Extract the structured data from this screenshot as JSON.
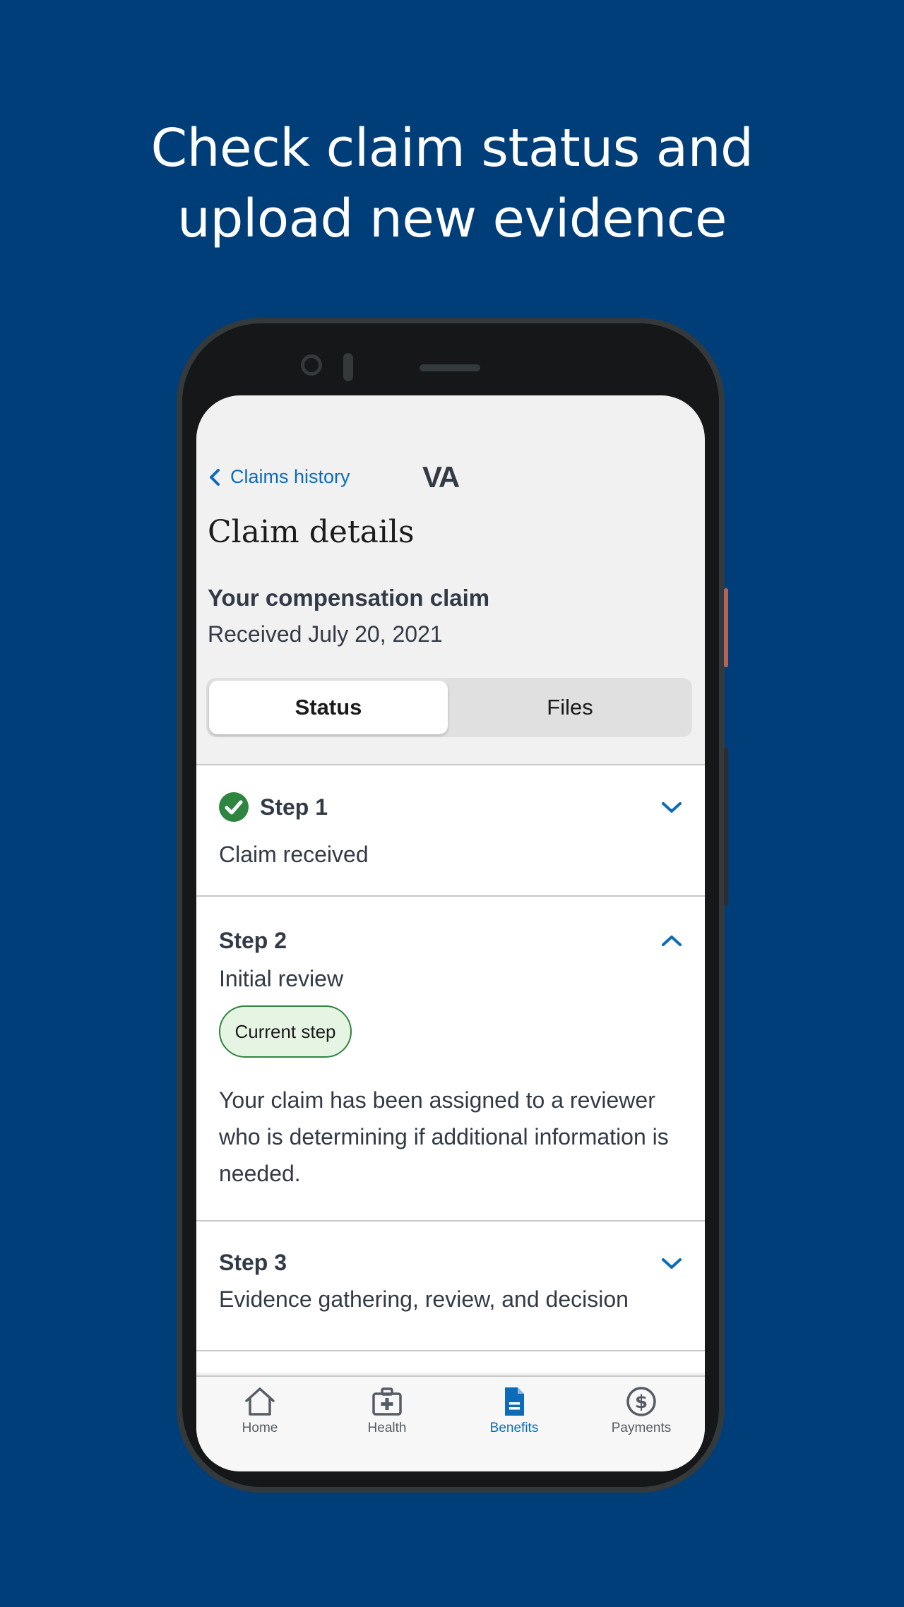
{
  "headline": {
    "line1": "Check claim status and",
    "line2": "upload new evidence"
  },
  "header": {
    "back_label": "Claims history",
    "logo_text": "VA"
  },
  "page": {
    "title": "Claim details",
    "claim_name": "Your compensation claim",
    "claim_date": "Received July 20, 2021"
  },
  "segment": {
    "status_label": "Status",
    "files_label": "Files",
    "selected": "Status"
  },
  "steps": [
    {
      "title": "Step 1",
      "subtitle": "Claim received",
      "completed": true,
      "expanded": false
    },
    {
      "title": "Step 2",
      "subtitle": "Initial review",
      "badge": "Current step",
      "description": "Your claim has been assigned to a reviewer who is determining if additional information is needed.",
      "expanded": true
    },
    {
      "title": "Step 3",
      "subtitle": "Evidence gathering, review, and decision",
      "expanded": false
    }
  ],
  "tabs": [
    {
      "label": "Home",
      "icon": "home-icon"
    },
    {
      "label": "Health",
      "icon": "medical-kit-icon"
    },
    {
      "label": "Benefits",
      "icon": "document-icon",
      "active": true
    },
    {
      "label": "Payments",
      "icon": "dollar-circle-icon"
    }
  ],
  "colors": {
    "background": "#003e79",
    "link": "#0c6cb8",
    "success": "#2e8540",
    "badge_bg": "#e6f5e3"
  }
}
